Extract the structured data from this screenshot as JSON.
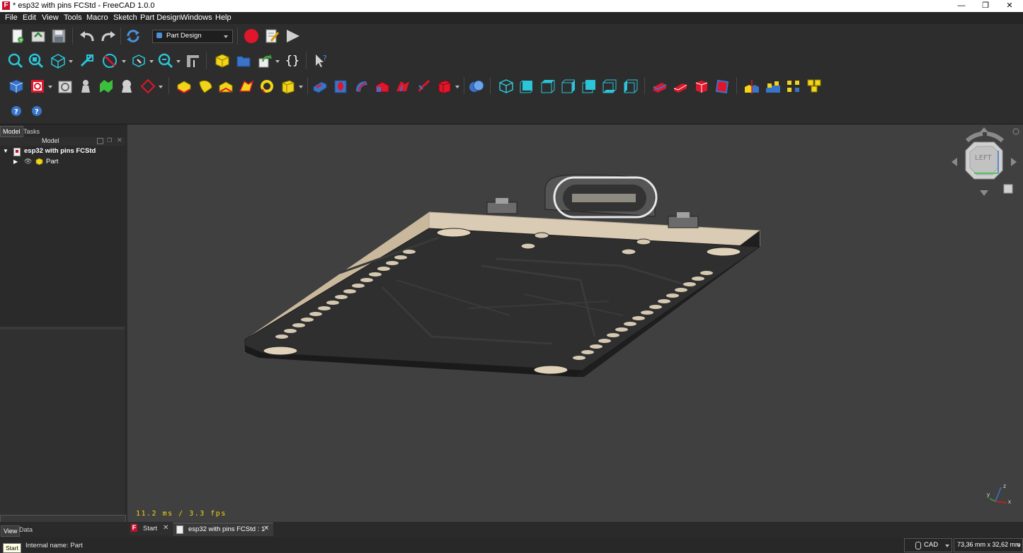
{
  "window": {
    "title": "* esp32 with pins FCStd - FreeCAD 1.0.0",
    "logo": "F",
    "controls": [
      "—",
      "❐",
      "✕"
    ]
  },
  "menubar": [
    "File",
    "Edit",
    "View",
    "Tools",
    "Macro",
    "Sketch",
    "Part Design",
    "Windows",
    "Help"
  ],
  "toolbar1": {
    "workbench_selected": "Part Design"
  },
  "toolbar4": {
    "whatsthis_icons": [
      "help-icon",
      "whats-this-icon"
    ]
  },
  "icons": {
    "t1": [
      "new-document-icon",
      "open-document-icon",
      "save-icon",
      "undo-icon",
      "redo-icon",
      "refresh-icon",
      "macro-record-icon",
      "macro-edit-icon",
      "macro-run-icon"
    ],
    "t2": [
      "fit-all-icon",
      "fit-selection-icon",
      "view-isometric-icon",
      "measure-icon",
      "draw-style-icon",
      "bounding-box-icon",
      "zoom-icon",
      "measure-tool-icon",
      "part-icon",
      "group-icon",
      "link-icon",
      "braces-icon",
      "whats-this-icon"
    ],
    "t3": [
      "body-icon",
      "sketch-icon",
      "attach-icon",
      "clone-icon",
      "datum-icon",
      "shape-binder-icon",
      "pad-icon",
      "revolution-icon",
      "loft-icon",
      "pipe-icon",
      "helix-icon",
      "additive-primitive-icon",
      "pocket-icon",
      "hole-icon",
      "groove-icon",
      "subtractive-loft-icon",
      "subtractive-pipe-icon",
      "subtractive-helix-icon",
      "subtractive-primitive-icon",
      "boolean-icon",
      "view-iso-icon",
      "view-front-icon",
      "view-top-icon",
      "view-right-icon",
      "view-rear-icon",
      "view-bottom-icon",
      "view-left-icon",
      "fillet-icon",
      "chamfer-icon",
      "draft-icon",
      "thickness-icon",
      "mirrored-icon",
      "linear-pattern-icon",
      "polar-pattern-icon",
      "multi-transform-icon"
    ]
  },
  "colors": {
    "accent_red": "#e0162b",
    "primary_yellow": "#f2d418",
    "cyan": "#2bc4d8",
    "blue": "#3a74c9",
    "pcb_dark": "#2e2e2e",
    "pcb_edge": "#d9cbb4"
  },
  "left_panel": {
    "tabs": [
      "Model",
      "Tasks"
    ],
    "header": "Model",
    "tree": [
      {
        "label": "esp32 with pins FCStd",
        "expanded": true
      },
      {
        "label": "Part",
        "expanded": false
      }
    ],
    "bottom_tabs": [
      "View",
      "Data"
    ]
  },
  "view3d": {
    "fps_text": "11.2 ms / 3.3 fps",
    "navcube_face": "LEFT",
    "axis_labels": [
      "z",
      "y",
      "x"
    ]
  },
  "doc_tabs": [
    {
      "label": "Start",
      "active": false
    },
    {
      "label": "esp32 with pins FCStd : 1*",
      "active": true
    }
  ],
  "status": {
    "text": "Internal name: Part",
    "tooltip": "Start",
    "nav_style": "CAD",
    "dimensions": "73,36 mm x 32,62 mm"
  }
}
